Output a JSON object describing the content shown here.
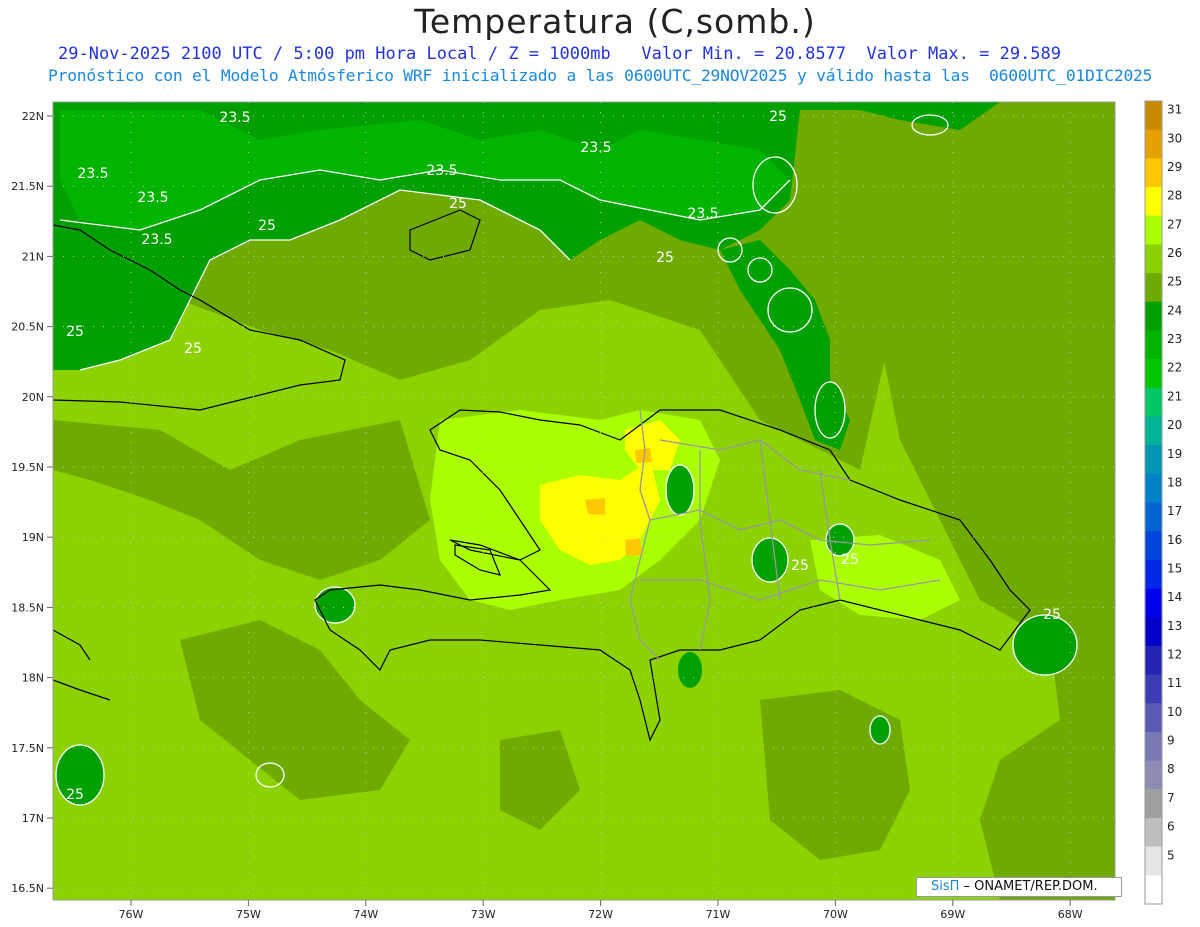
{
  "title": "Temperatura (C,somb.)",
  "subtitle_line1": "29-Nov-2025 2100 UTC / 5:00 pm Hora Local / Z = 1000mb   Valor Min. = 20.8577  Valor Max. = 29.589",
  "subtitle_line2": "Pronóstico con el Modelo Atmósferico WRF inicializado a las 0600UTC_29NOV2025 y válido hasta las  0600UTC_01DIC2025",
  "credit_sis": "SisΠ",
  "credit_rest": " –  ONAMET/REP.DOM.",
  "lat_labels": [
    "22N",
    "21.5N",
    "21N",
    "20.5N",
    "20N",
    "19.5N",
    "19N",
    "18.5N",
    "18N",
    "17.5N",
    "17N",
    "16.5N"
  ],
  "lon_labels": [
    "76W",
    "75W",
    "74W",
    "73W",
    "72W",
    "71W",
    "70W",
    "69W",
    "68W"
  ],
  "contour_labels": [
    "23.5",
    "23.5",
    "23.5",
    "23.5",
    "23.5",
    "23.5",
    "23.5",
    "25",
    "25",
    "25",
    "25",
    "25",
    "25",
    "25",
    "25",
    "25",
    "25"
  ],
  "colorbar": {
    "labels": [
      "31",
      "30",
      "29",
      "28",
      "27",
      "26",
      "25",
      "24",
      "23",
      "22",
      "21",
      "20",
      "19",
      "18",
      "17",
      "16",
      "15",
      "14",
      "13",
      "12",
      "11",
      "10",
      "9",
      "8",
      "7",
      "6",
      "5"
    ],
    "colors": [
      "#c88a00",
      "#e6a000",
      "#ffc800",
      "#ffff00",
      "#aaff00",
      "#8cd200",
      "#6eaa00",
      "#00a000",
      "#00b400",
      "#00c800",
      "#00c864",
      "#00b496",
      "#0096b4",
      "#0082c8",
      "#0064d2",
      "#0046dc",
      "#0028e6",
      "#0000f0",
      "#0000c8",
      "#2323b4",
      "#3c3cb4",
      "#5a5ab4",
      "#7878b4",
      "#8c8cb4",
      "#a0a0a0",
      "#bebebe",
      "#e6e6e6",
      "#ffffff"
    ]
  },
  "colors": {
    "base_green": "#8cd200",
    "dark_green": "#6eaa00",
    "green24": "#00a000",
    "green23": "#00b400",
    "yellow_green": "#aaff00",
    "yellow": "#ffff00",
    "orange": "#ffc800",
    "coast": "#000000",
    "border": "#999999"
  }
}
